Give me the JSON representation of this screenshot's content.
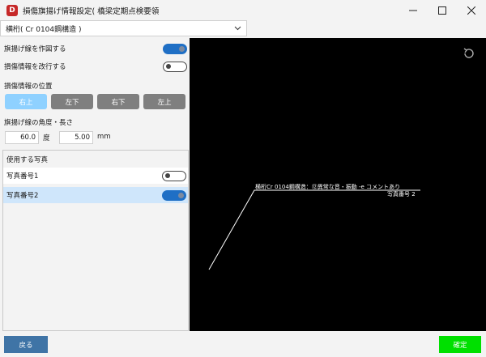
{
  "window": {
    "app_icon_letter": "D",
    "title": "損傷旗揚げ情報設定( 橋梁定期点検要領"
  },
  "member_select": {
    "value": "横桁( Cr 0104鋼構造 )"
  },
  "settings": {
    "draw_flag_line_label": "旗揚げ線を作図する",
    "draw_flag_line_on": true,
    "wrap_info_label": "損傷情報を改行する",
    "wrap_info_on": false,
    "position_label": "損傷情報の位置",
    "positions": [
      "右上",
      "左下",
      "右下",
      "左上"
    ],
    "selected_position": "右上",
    "angle_length_label": "旗揚げ線の角度・長さ",
    "angle_value": "60.0",
    "angle_unit": "度",
    "length_value": "5.00",
    "length_unit": "mm"
  },
  "photos": {
    "header": "使用する写真",
    "items": [
      {
        "label": "写真番号1",
        "on": false
      },
      {
        "label": "写真番号2",
        "on": true
      }
    ]
  },
  "preview": {
    "damage_text": "横桁Cr 0104鋼構造：⑫異常な音・振動 -e コメントあり",
    "photo_text": "写真番号 2",
    "line_color": "#ffffff"
  },
  "footer": {
    "back_label": "戻る",
    "ok_label": "確定"
  },
  "colors": {
    "toggle_on": "#1f6fc5",
    "position_active": "#8fd1ff",
    "back_button": "#3f74a6",
    "ok_button": "#00e000"
  }
}
